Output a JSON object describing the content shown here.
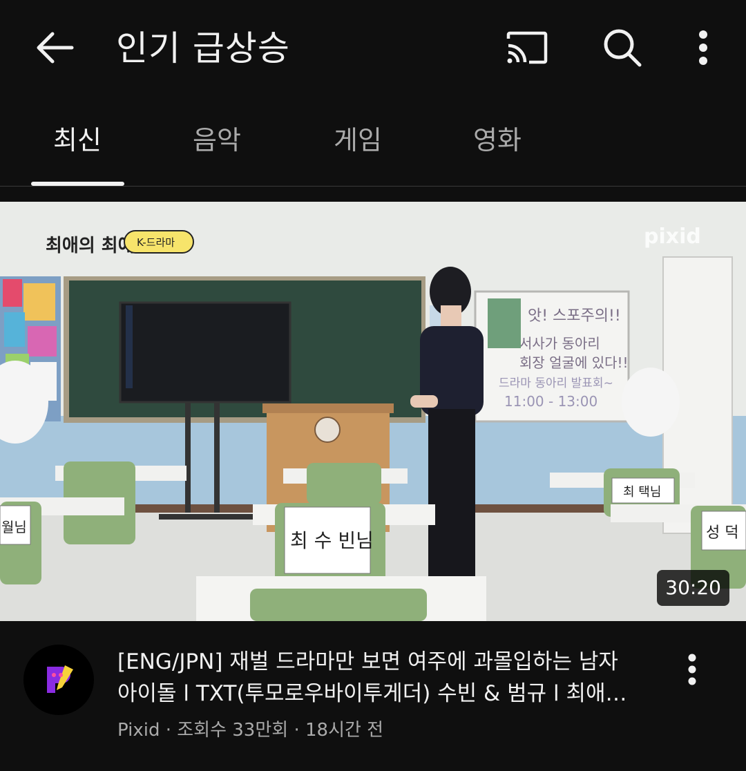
{
  "header": {
    "title": "인기 급상승",
    "icons": [
      "back-arrow-icon",
      "cast-icon",
      "search-icon",
      "more-vert-icon"
    ]
  },
  "tabs": [
    {
      "label": "최신",
      "selected": true
    },
    {
      "label": "음악",
      "selected": false
    },
    {
      "label": "게임",
      "selected": false
    },
    {
      "label": "영화",
      "selected": false
    }
  ],
  "video": {
    "thumbnail": {
      "show_logo": "최애의 최애",
      "badge": "K-드라마",
      "brand": "pixid",
      "board_text": [
        "앗! 스포주의!!",
        "서사가 동아리",
        "회장 얼굴에 있다!!",
        "드라마 동아리 발표회~",
        "11:00 - 13:00"
      ],
      "name_tags": [
        "월님",
        "최 수 빈님",
        "최 택님",
        "성 덕"
      ]
    },
    "duration": "30:20",
    "title_line1": "[ENG/JPN] 재벌 드라마만 보면 여주에 과몰입하는 남자",
    "title_line2": "아이돌 l TXT(투모로우바이투게더) 수빈 & 범규 l 최애…",
    "channel_info": "Pixid · 조회수 33만회 · 18시간 전"
  },
  "colors": {
    "background": "#0f0f0f",
    "text_primary": "#f1f1f1",
    "text_secondary": "#aaaaaa",
    "divider": "#3a3a3a"
  }
}
